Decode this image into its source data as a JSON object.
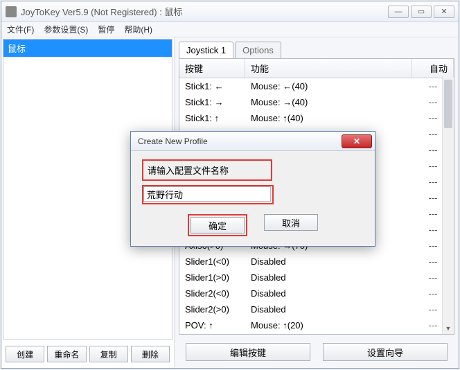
{
  "window": {
    "title": "JoyToKey Ver5.9 (Not Registered) : 鼠标"
  },
  "menu": {
    "file": "文件(F)",
    "settings": "参数设置(S)",
    "pause": "暂停",
    "help": "帮助(H)"
  },
  "sidebar": {
    "selected_profile": "鼠标",
    "btn_create": "创建",
    "btn_rename": "重命名",
    "btn_copy": "复制",
    "btn_delete": "删除"
  },
  "tabs": {
    "joystick": "Joystick 1",
    "options": "Options"
  },
  "columns": {
    "key": "按键",
    "func": "功能",
    "auto": "自动"
  },
  "rows": [
    {
      "k": "Stick1: ←",
      "f": "Mouse: ←(40)",
      "a": "---"
    },
    {
      "k": "Stick1: →",
      "f": "Mouse: →(40)",
      "a": "---"
    },
    {
      "k": "Stick1: ↑",
      "f": "Mouse: ↑(40)",
      "a": "---"
    },
    {
      "k": "",
      "f": "",
      "a": "---"
    },
    {
      "k": "",
      "f": "",
      "a": "---"
    },
    {
      "k": "",
      "f": "",
      "a": "---"
    },
    {
      "k": "",
      "f": "",
      "a": "---"
    },
    {
      "k": "",
      "f": "",
      "a": "---"
    },
    {
      "k": "",
      "f": "",
      "a": "---"
    },
    {
      "k": "",
      "f": "",
      "a": "---"
    },
    {
      "k": "Axis6(>0)",
      "f": "Mouse: →(70)",
      "a": "---"
    },
    {
      "k": "Slider1(<0)",
      "f": "Disabled",
      "a": "---"
    },
    {
      "k": "Slider1(>0)",
      "f": "Disabled",
      "a": "---"
    },
    {
      "k": "Slider2(<0)",
      "f": "Disabled",
      "a": "---"
    },
    {
      "k": "Slider2(>0)",
      "f": "Disabled",
      "a": "---"
    },
    {
      "k": "POV: ↑",
      "f": "Mouse: ↑(20)",
      "a": "---"
    }
  ],
  "bottom": {
    "edit": "编辑按键",
    "wizard": "设置向导"
  },
  "dialog": {
    "title": "Create New Profile",
    "label": "请输入配置文件名称",
    "value": "荒野行动",
    "ok": "确定",
    "cancel": "取消"
  }
}
